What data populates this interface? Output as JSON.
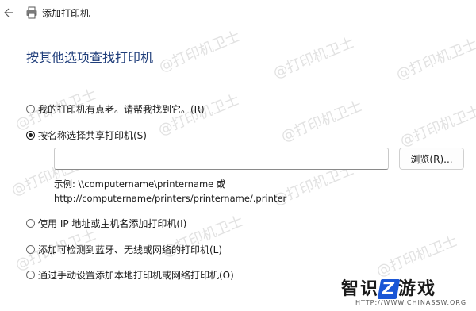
{
  "window": {
    "title": "添加打印机",
    "back_icon": "arrow-left-icon",
    "app_icon": "printer-icon"
  },
  "main": {
    "heading": "按其他选项查找打印机",
    "options": [
      {
        "label": "我的打印机有点老。请帮我找到它。(R)",
        "checked": false
      },
      {
        "label": "按名称选择共享打印机(S)",
        "checked": true
      },
      {
        "label": "使用 IP 地址或主机名添加打印机(I)",
        "checked": false
      },
      {
        "label": "添加可检测到蓝牙、无线或网络的打印机(L)",
        "checked": false
      },
      {
        "label": "通过手动设置添加本地打印机或网络打印机(O)",
        "checked": false
      }
    ],
    "name_input": {
      "value": "",
      "placeholder": ""
    },
    "browse_label": "浏览(R)...",
    "example_line1": "示例: \\\\computername\\printername 或",
    "example_line2": "http://computername/printers/printername/.printer"
  },
  "watermark": {
    "text": "@打印机卫士"
  },
  "logo": {
    "brand_a": "智识",
    "brand_z": "Z",
    "brand_b": "游戏",
    "url": "HTTP://WWW.CHINASSW.ORG"
  },
  "colors": {
    "heading": "#1f3d7a",
    "accent": "#1a56d6"
  }
}
